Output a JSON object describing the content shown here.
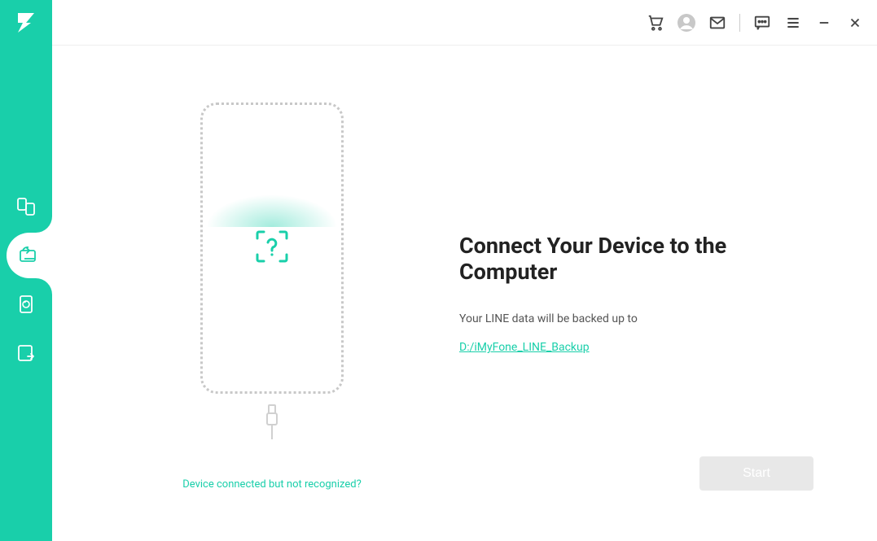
{
  "app": {
    "brand_color": "#19cfaa"
  },
  "sidebar": {
    "logo": "logo-icon",
    "items": [
      {
        "name": "transfer",
        "icon_name": "transfer-icon"
      },
      {
        "name": "backup",
        "icon_name": "backup-icon",
        "active": true
      },
      {
        "name": "restore",
        "icon_name": "restore-icon"
      },
      {
        "name": "export",
        "icon_name": "export-icon"
      }
    ]
  },
  "header": {
    "icons": [
      "cart",
      "user",
      "mail",
      "chat",
      "menu",
      "minimize",
      "close"
    ]
  },
  "device": {
    "help_link_text": "Device connected but not recognized?",
    "scan_icon": "question-scan-icon"
  },
  "info": {
    "title": "Connect Your Device to the Computer",
    "subtitle": "Your LINE data will be backed up to",
    "path": "D:/iMyFone_LINE_Backup"
  },
  "action": {
    "start_label": "Start"
  }
}
